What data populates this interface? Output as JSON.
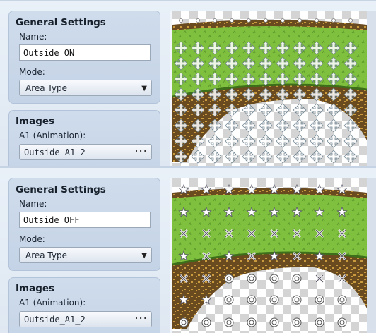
{
  "panels": [
    {
      "general_title": "General Settings",
      "name_label": "Name:",
      "name_value": "Outside ON",
      "mode_label": "Mode:",
      "mode_value": "Area Type",
      "images_title": "Images",
      "a1_label": "A1 (Animation):",
      "a1_value": "Outside_A1_2",
      "picker_button": "···",
      "marker_icons": [
        "move-arrow-icon",
        "circle-icon"
      ]
    },
    {
      "general_title": "General Settings",
      "name_label": "Name:",
      "name_value": "Outside OFF",
      "mode_label": "Mode:",
      "mode_value": "Area Type",
      "images_title": "Images",
      "a1_label": "A1 (Animation):",
      "a1_value": "Outside_A1_2",
      "picker_button": "···",
      "marker_icons": [
        "star-icon",
        "x-icon",
        "double-circle-icon"
      ]
    }
  ],
  "colors": {
    "grass": "#7fc03f",
    "grass_dark": "#5d9a2c",
    "dirt": "#6a4a1f",
    "dirt_light": "#c99a3e",
    "checker_light": "#ffffff",
    "checker_dark": "#d4d4d4"
  }
}
